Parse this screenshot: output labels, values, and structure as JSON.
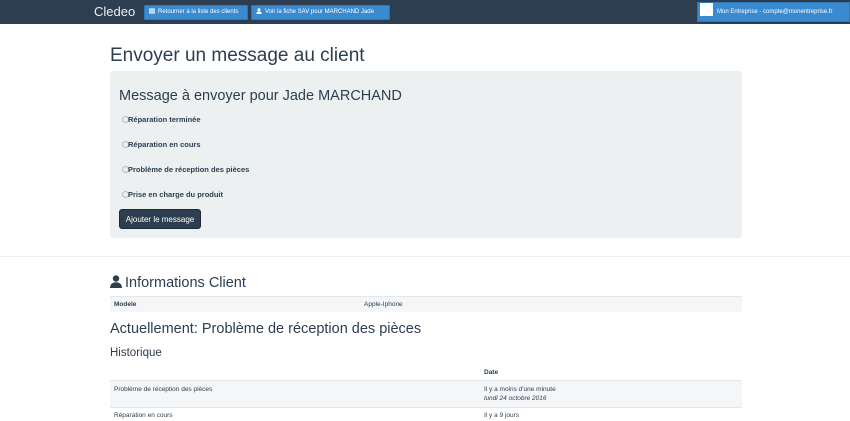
{
  "navbar": {
    "brand": "Cledeo",
    "back_label": "Retourner à la liste des clients",
    "sav_label": "Voir la fiche SAV pour MARCHAND Jade",
    "account_label": "Mon Entreprise - compte@monentreprise.fr"
  },
  "page": {
    "title": "Envoyer un message au client"
  },
  "message_form": {
    "title": "Message à envoyer pour Jade MARCHAND",
    "options": [
      "Réparation terminée",
      "Réparation en cours",
      "Problème de réception des pièces",
      "Prise en charge du produit"
    ],
    "submit_label": "Ajouter le message"
  },
  "client_info": {
    "title": "Informations Client",
    "model_label": "Modele",
    "model_value": "Apple-Iphone"
  },
  "status": {
    "current": "Actuellement: Problème de réception des pièces",
    "history_title": "Historique",
    "date_header": "Date",
    "rows": [
      {
        "status": "Problème de réception des pièces",
        "relative": "Il y a moins d'une minute",
        "date": "lundi 24 octobre 2016"
      },
      {
        "status": "Réparation en cours",
        "relative": "Il y a 9 jours",
        "date": ""
      }
    ]
  },
  "colors": {
    "navbar": "#2c3e50",
    "primary_button": "#3a8ad0",
    "well": "#ecf0f1",
    "text": "#2c3e50"
  },
  "icons": {
    "list": "list-icon",
    "user": "user-icon",
    "avatar": "avatar"
  }
}
